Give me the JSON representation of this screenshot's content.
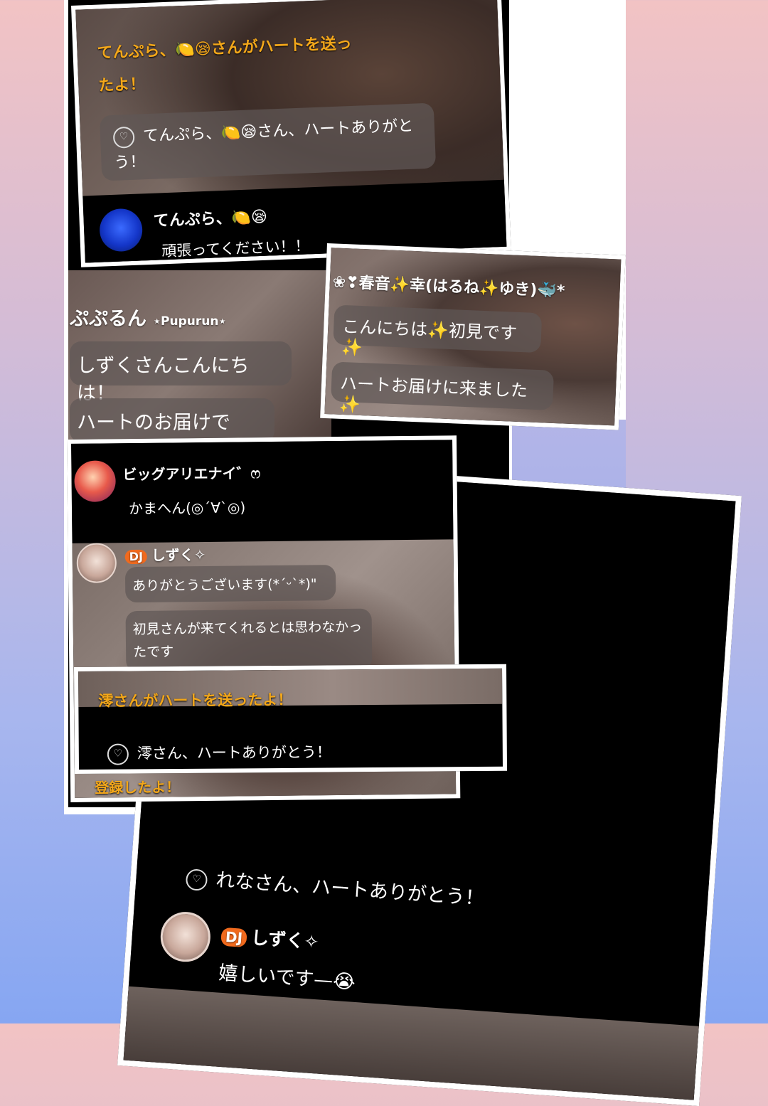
{
  "card1": {
    "banner": "てんぷら、🍋😪さんがハートを送ったよ！",
    "heart_msg": "てんぷら、🍋😪さん、ハートありがとう！",
    "user_name": "てんぷら、🍋😪",
    "user_msg": "頑張ってください！！"
  },
  "card2": {
    "name": "ぷぷるん",
    "name_tag": "⋆Pupurun⋆",
    "msg1": "しずくさんこんにちは！",
    "msg2": "ハートのお届けです！"
  },
  "card3": {
    "name": "❀❣春音✨幸(はるね✨ゆき)🐳*",
    "msg1": "こんにちは✨初見です✨",
    "msg2": "ハートお届けに来ました✨"
  },
  "card4": {
    "user1_name": "ビッグアリエナイ゛ෆ",
    "user1_msg": "かまへん(◎´∀`◎)",
    "dj_badge": "DJ",
    "user2_name": "しずく✧",
    "reply1": "ありがとうございます(*ˊᵕˋ*)\"",
    "reply2": "初見さんが来てくれるとは思わなかったです",
    "bottom_partial": "登録したよ！"
  },
  "card5": {
    "banner": "澪さんがハートを送ったよ！",
    "heart_msg": "澪さん、ハートありがとう！"
  },
  "card6": {
    "heart_msg": "れなさん、ハートありがとう！",
    "dj_badge": "DJ",
    "user_name": "しずく✧",
    "user_msg": "嬉しいです—😭"
  },
  "colors": {
    "accent_orange": "#f3a71a",
    "dj_badge": "#f06a1e"
  }
}
